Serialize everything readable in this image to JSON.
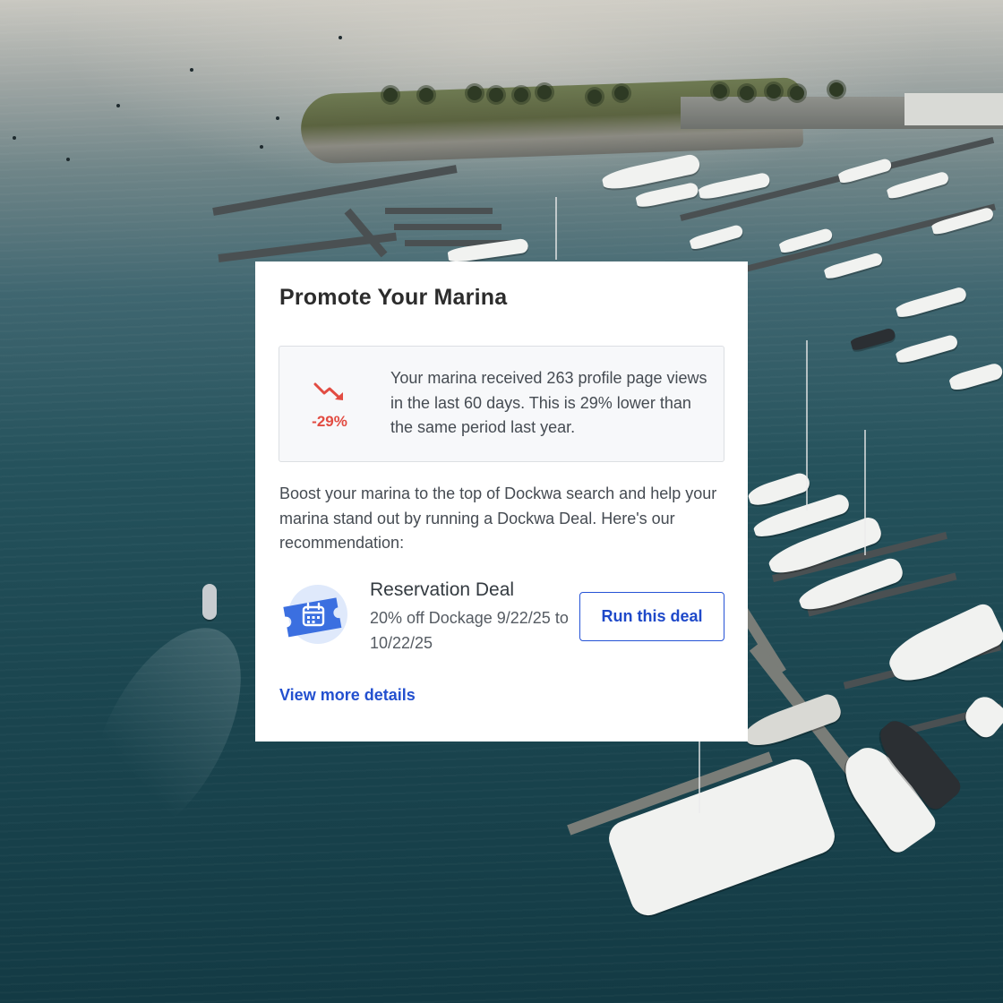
{
  "card": {
    "title": "Promote Your Marina",
    "stat": {
      "icon": "trending-down-icon",
      "change": "-29%",
      "text": "Your marina received 263 profile page views in the last 60 days. This is 29% lower than the same period last year."
    },
    "body": "Boost your marina to the top of Dockwa search and help your marina stand out by running a Dockwa Deal. Here's our recommendation:",
    "deal": {
      "icon": "calendar-ticket-icon",
      "title": "Reservation Deal",
      "description": "20% off Dockage 9/22/25 to 10/22/25",
      "button_label": "Run this deal"
    },
    "details_link": "View more details"
  },
  "colors": {
    "accent_blue": "#2552d6",
    "negative_red": "#e24c42",
    "deal_icon_blue": "#3b6fe0",
    "deal_icon_bg": "#dfe9fb"
  }
}
